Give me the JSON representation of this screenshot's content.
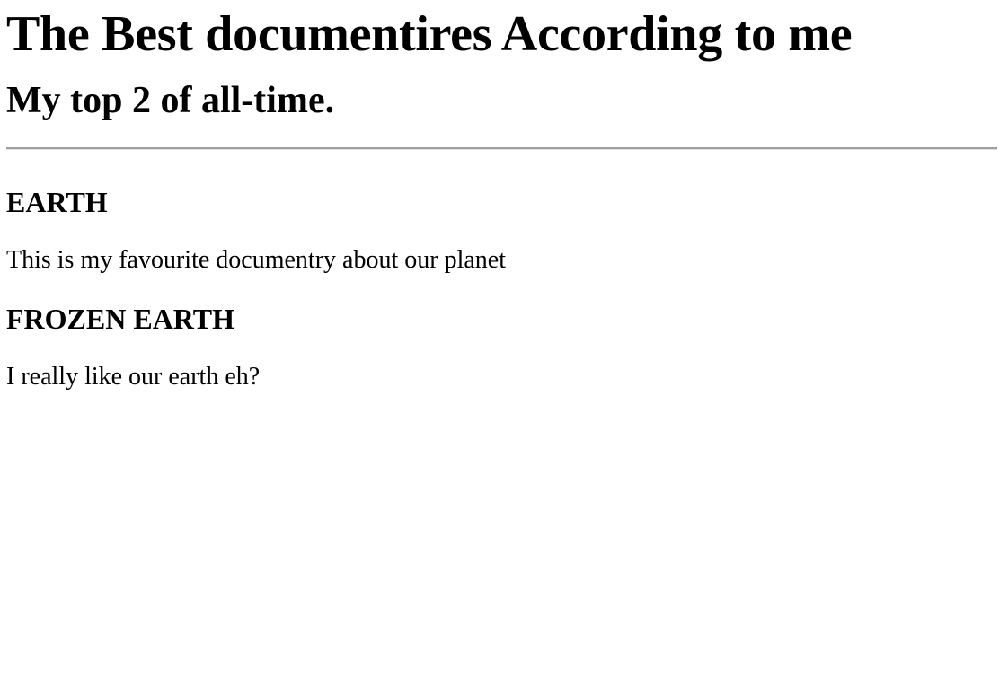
{
  "page": {
    "title": "The Best documentires According to me",
    "subtitle": "My top 2 of all-time."
  },
  "entries": [
    {
      "heading": "EARTH",
      "description": "This is my favourite documentry about our planet"
    },
    {
      "heading": "FROZEN EARTH",
      "description": "I really like our earth eh?"
    }
  ]
}
